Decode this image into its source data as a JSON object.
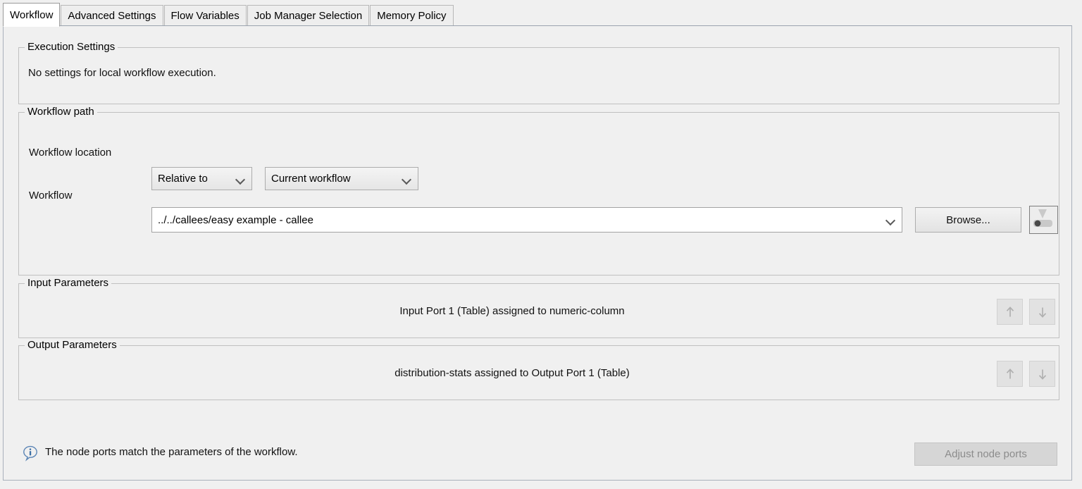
{
  "tabs": [
    {
      "label": "Workflow",
      "active": true
    },
    {
      "label": "Advanced Settings",
      "active": false
    },
    {
      "label": "Flow Variables",
      "active": false
    },
    {
      "label": "Job Manager Selection",
      "active": false
    },
    {
      "label": "Memory Policy",
      "active": false
    }
  ],
  "execution_settings": {
    "legend": "Execution Settings",
    "text": "No settings for local workflow execution."
  },
  "workflow_path": {
    "legend": "Workflow path",
    "location_label": "Workflow location",
    "location_mode": "Relative to",
    "location_target": "Current workflow",
    "workflow_label": "Workflow",
    "workflow_value": "../../callees/easy example - callee",
    "workflow_placeholder": "",
    "browse_label": "Browse...",
    "flow_variable_icon": "flow-variable-icon"
  },
  "input_parameters": {
    "legend": "Input Parameters",
    "rows": [
      "Input Port 1 (Table) assigned to numeric-column"
    ],
    "move_up_icon": "arrow-up-icon",
    "move_down_icon": "arrow-down-icon"
  },
  "output_parameters": {
    "legend": "Output Parameters",
    "rows": [
      "distribution-stats assigned to Output Port 1 (Table)"
    ],
    "move_up_icon": "arrow-up-icon",
    "move_down_icon": "arrow-down-icon"
  },
  "status": {
    "icon": "info-icon",
    "message": "The node ports match the parameters of the workflow.",
    "adjust_button_label": "Adjust node ports"
  },
  "colors": {
    "panel_background": "#f0f0f0",
    "active_tab_background": "#ffffff",
    "field_background": "#ffffff",
    "info_icon": "#3a6ea5",
    "disabled_text": "#8c8c8c",
    "group_border": "#c0c0c0"
  }
}
